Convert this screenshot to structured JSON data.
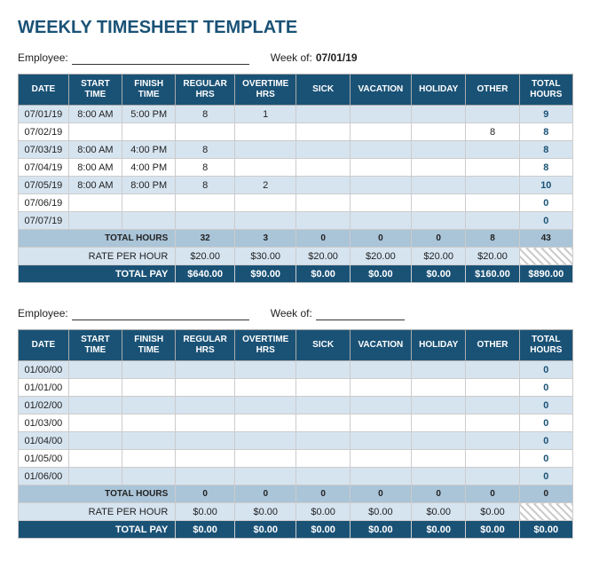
{
  "title": "WEEKLY TIMESHEET TEMPLATE",
  "section1": {
    "employee_label": "Employee:",
    "employee_value": "",
    "week_label": "Week of:",
    "week_value": "07/01/19",
    "headers": [
      "DATE",
      "START TIME",
      "FINISH TIME",
      "REGULAR HRS",
      "OVERTIME HRS",
      "SICK",
      "VACATION",
      "HOLIDAY",
      "OTHER",
      "TOTAL HOURS"
    ],
    "rows": [
      {
        "date": "07/01/19",
        "start": "8:00 AM",
        "finish": "5:00 PM",
        "reg": "8",
        "ot": "1",
        "sick": "",
        "vacation": "",
        "holiday": "",
        "other": "",
        "total": "9"
      },
      {
        "date": "07/02/19",
        "start": "",
        "finish": "",
        "reg": "",
        "ot": "",
        "sick": "",
        "vacation": "",
        "holiday": "",
        "other": "8",
        "total": "8"
      },
      {
        "date": "07/03/19",
        "start": "8:00 AM",
        "finish": "4:00 PM",
        "reg": "8",
        "ot": "",
        "sick": "",
        "vacation": "",
        "holiday": "",
        "other": "",
        "total": "8"
      },
      {
        "date": "07/04/19",
        "start": "8:00 AM",
        "finish": "4:00 PM",
        "reg": "8",
        "ot": "",
        "sick": "",
        "vacation": "",
        "holiday": "",
        "other": "",
        "total": "8"
      },
      {
        "date": "07/05/19",
        "start": "8:00 AM",
        "finish": "8:00 PM",
        "reg": "8",
        "ot": "2",
        "sick": "",
        "vacation": "",
        "holiday": "",
        "other": "",
        "total": "10"
      },
      {
        "date": "07/06/19",
        "start": "",
        "finish": "",
        "reg": "",
        "ot": "",
        "sick": "",
        "vacation": "",
        "holiday": "",
        "other": "",
        "total": "0"
      },
      {
        "date": "07/07/19",
        "start": "",
        "finish": "",
        "reg": "",
        "ot": "",
        "sick": "",
        "vacation": "",
        "holiday": "",
        "other": "",
        "total": "0"
      }
    ],
    "total_row": {
      "label": "TOTAL HOURS",
      "reg": "32",
      "ot": "3",
      "sick": "0",
      "vacation": "0",
      "holiday": "0",
      "other": "8",
      "total": "43"
    },
    "rate_row": {
      "label": "RATE PER HOUR",
      "reg": "$20.00",
      "ot": "$30.00",
      "sick": "$20.00",
      "vacation": "$20.00",
      "holiday": "$20.00",
      "other": "$20.00"
    },
    "pay_row": {
      "label": "TOTAL PAY",
      "reg": "$640.00",
      "ot": "$90.00",
      "sick": "$0.00",
      "vacation": "$0.00",
      "holiday": "$0.00",
      "other": "$160.00",
      "total": "$890.00"
    }
  },
  "section2": {
    "employee_label": "Employee:",
    "employee_value": "",
    "week_label": "Week of:",
    "week_value": "",
    "headers": [
      "DATE",
      "START TIME",
      "FINISH TIME",
      "REGULAR HRS",
      "OVERTIME HRS",
      "SICK",
      "VACATION",
      "HOLIDAY",
      "OTHER",
      "TOTAL HOURS"
    ],
    "rows": [
      {
        "date": "01/00/00",
        "start": "",
        "finish": "",
        "reg": "",
        "ot": "",
        "sick": "",
        "vacation": "",
        "holiday": "",
        "other": "",
        "total": "0"
      },
      {
        "date": "01/01/00",
        "start": "",
        "finish": "",
        "reg": "",
        "ot": "",
        "sick": "",
        "vacation": "",
        "holiday": "",
        "other": "",
        "total": "0"
      },
      {
        "date": "01/02/00",
        "start": "",
        "finish": "",
        "reg": "",
        "ot": "",
        "sick": "",
        "vacation": "",
        "holiday": "",
        "other": "",
        "total": "0"
      },
      {
        "date": "01/03/00",
        "start": "",
        "finish": "",
        "reg": "",
        "ot": "",
        "sick": "",
        "vacation": "",
        "holiday": "",
        "other": "",
        "total": "0"
      },
      {
        "date": "01/04/00",
        "start": "",
        "finish": "",
        "reg": "",
        "ot": "",
        "sick": "",
        "vacation": "",
        "holiday": "",
        "other": "",
        "total": "0"
      },
      {
        "date": "01/05/00",
        "start": "",
        "finish": "",
        "reg": "",
        "ot": "",
        "sick": "",
        "vacation": "",
        "holiday": "",
        "other": "",
        "total": "0"
      },
      {
        "date": "01/06/00",
        "start": "",
        "finish": "",
        "reg": "",
        "ot": "",
        "sick": "",
        "vacation": "",
        "holiday": "",
        "other": "",
        "total": "0"
      }
    ],
    "total_row": {
      "label": "TOTAL HOURS",
      "reg": "0",
      "ot": "0",
      "sick": "0",
      "vacation": "0",
      "holiday": "0",
      "other": "0",
      "total": "0"
    },
    "rate_row": {
      "label": "RATE PER HOUR",
      "reg": "$0.00",
      "ot": "$0.00",
      "sick": "$0.00",
      "vacation": "$0.00",
      "holiday": "$0.00",
      "other": "$0.00"
    },
    "pay_row": {
      "label": "TOTAL PAY",
      "reg": "$0.00",
      "ot": "$0.00",
      "sick": "$0.00",
      "vacation": "$0.00",
      "holiday": "$0.00",
      "other": "$0.00",
      "total": "$0.00"
    }
  }
}
